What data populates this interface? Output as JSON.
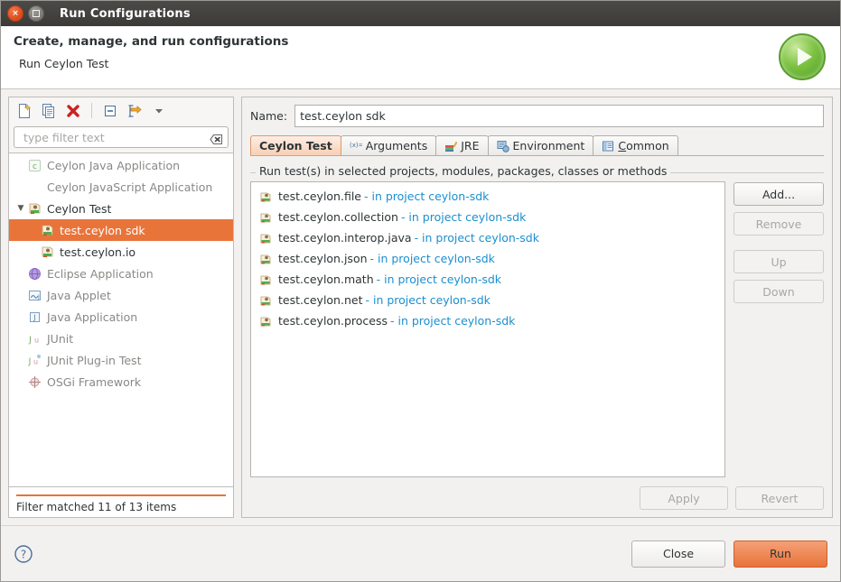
{
  "window": {
    "title": "Run Configurations",
    "close_glyph": "×",
    "maximize_name": "maximize-button"
  },
  "banner": {
    "title": "Create, manage, and run configurations",
    "subtitle": "Run Ceylon Test",
    "icon": "run-play-icon"
  },
  "toolbar": {
    "items": [
      {
        "name": "new-configuration-icon",
        "label": "New launch configuration"
      },
      {
        "name": "duplicate-configuration-icon",
        "label": "Duplicate"
      },
      {
        "name": "delete-configuration-icon",
        "label": "Delete"
      },
      {
        "name": "collapse-all-icon",
        "label": "Collapse All"
      },
      {
        "name": "filter-configurations-icon",
        "label": "Filter launch configurations"
      },
      {
        "name": "view-menu-chevron-icon",
        "label": "View Menu"
      }
    ]
  },
  "filter": {
    "placeholder": "type filter text",
    "value": "",
    "clear_icon": "clear-filter-icon",
    "status": "Filter matched 11 of 13 items"
  },
  "tree": {
    "items": [
      {
        "label": "Ceylon Java Application",
        "icon": "ceylon-java-application-icon",
        "indent": 1,
        "state": "disabled",
        "twisty": ""
      },
      {
        "label": "Ceylon JavaScript Application",
        "icon": "none",
        "indent": 1,
        "state": "disabled",
        "twisty": ""
      },
      {
        "label": "Ceylon Test",
        "icon": "ceylon-test-icon",
        "indent": 0,
        "state": "enabled",
        "twisty": "▼"
      },
      {
        "label": "test.ceylon sdk",
        "icon": "ceylon-test-config-icon",
        "indent": 2,
        "state": "selected",
        "twisty": ""
      },
      {
        "label": "test.ceylon.io",
        "icon": "ceylon-test-config-icon",
        "indent": 2,
        "state": "enabled",
        "twisty": ""
      },
      {
        "label": "Eclipse Application",
        "icon": "eclipse-application-icon",
        "indent": 1,
        "state": "disabled",
        "twisty": ""
      },
      {
        "label": "Java Applet",
        "icon": "java-applet-icon",
        "indent": 1,
        "state": "disabled",
        "twisty": ""
      },
      {
        "label": "Java Application",
        "icon": "java-application-icon",
        "indent": 1,
        "state": "disabled",
        "twisty": ""
      },
      {
        "label": "JUnit",
        "icon": "junit-icon",
        "indent": 1,
        "state": "disabled",
        "twisty": ""
      },
      {
        "label": "JUnit Plug-in Test",
        "icon": "junit-plugin-test-icon",
        "indent": 1,
        "state": "disabled",
        "twisty": ""
      },
      {
        "label": "OSGi Framework",
        "icon": "osgi-framework-icon",
        "indent": 1,
        "state": "disabled",
        "twisty": ""
      }
    ]
  },
  "config": {
    "name_label": "Name:",
    "name_value": "test.ceylon sdk",
    "tabs": [
      {
        "label": "Ceylon Test",
        "icon": "none",
        "active": true
      },
      {
        "label": "Arguments",
        "icon": "arguments-icon",
        "active": false
      },
      {
        "label": "JRE",
        "icon": "jre-icon",
        "active": false
      },
      {
        "label": "Environment",
        "icon": "environment-icon",
        "active": false
      },
      {
        "label": "Common",
        "icon": "common-icon",
        "active": false,
        "mnemonic": "C"
      }
    ],
    "group_label": "Run test(s) in selected projects, modules, packages, classes or methods",
    "entries": [
      {
        "name": "test.ceylon.file",
        "suffix": "- in project ceylon-sdk",
        "icon": "ceylon-module-icon"
      },
      {
        "name": "test.ceylon.collection",
        "suffix": "- in project ceylon-sdk",
        "icon": "ceylon-module-icon"
      },
      {
        "name": "test.ceylon.interop.java",
        "suffix": "- in project ceylon-sdk",
        "icon": "ceylon-module-icon"
      },
      {
        "name": "test.ceylon.json",
        "suffix": "- in project ceylon-sdk",
        "icon": "ceylon-module-icon"
      },
      {
        "name": "test.ceylon.math",
        "suffix": "- in project ceylon-sdk",
        "icon": "ceylon-module-icon"
      },
      {
        "name": "test.ceylon.net",
        "suffix": "- in project ceylon-sdk",
        "icon": "ceylon-module-icon"
      },
      {
        "name": "test.ceylon.process",
        "suffix": "- in project ceylon-sdk",
        "icon": "ceylon-module-icon"
      }
    ],
    "side_buttons": [
      {
        "label": "Add...",
        "enabled": true
      },
      {
        "label": "Remove",
        "enabled": false
      },
      {
        "label": "Up",
        "enabled": false
      },
      {
        "label": "Down",
        "enabled": false
      }
    ],
    "apply_label": "Apply",
    "apply_enabled": false,
    "revert_label": "Revert",
    "revert_enabled": false
  },
  "footer": {
    "help_icon": "help-icon",
    "close_label": "Close",
    "run_label": "Run"
  },
  "colors": {
    "accent_orange": "#e8743a",
    "link_blue": "#1a8fd0",
    "title_bar": "#3c3b38",
    "text": "#2e3436",
    "disabled_text": "#8a8885"
  }
}
